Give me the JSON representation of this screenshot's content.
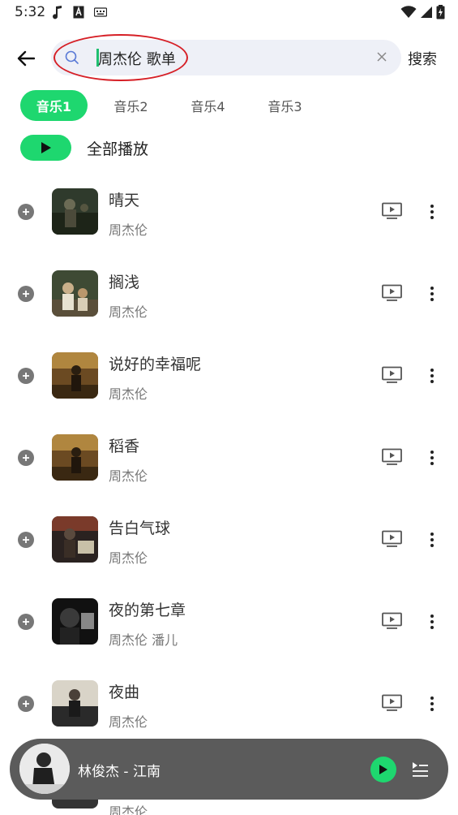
{
  "status_bar": {
    "time": "5:32",
    "icons": [
      "music-note-icon",
      "a-badge-icon",
      "keyboard-icon",
      "wifi-icon",
      "signal-icon",
      "battery-icon"
    ]
  },
  "search": {
    "query": "周杰伦 歌单",
    "submit_label": "搜索",
    "icons": [
      "back-arrow-icon",
      "search-icon",
      "clear-icon"
    ]
  },
  "tabs": [
    {
      "label": "音乐1",
      "active": true
    },
    {
      "label": "音乐2",
      "active": false
    },
    {
      "label": "音乐4",
      "active": false
    },
    {
      "label": "音乐3",
      "active": false
    }
  ],
  "play_all": {
    "label": "全部播放"
  },
  "songs": [
    {
      "title": "晴天",
      "artist": "周杰伦"
    },
    {
      "title": "搁浅",
      "artist": "周杰伦"
    },
    {
      "title": "说好的幸福呢",
      "artist": "周杰伦"
    },
    {
      "title": "稻香",
      "artist": "周杰伦"
    },
    {
      "title": "告白气球",
      "artist": "周杰伦"
    },
    {
      "title": "夜的第七章",
      "artist": "周杰伦 潘儿"
    },
    {
      "title": "夜曲",
      "artist": "周杰伦"
    }
  ],
  "partial_row": {
    "artist": "周杰伦"
  },
  "player": {
    "title": "林俊杰 - 江南"
  },
  "colors": {
    "accent": "#1ed76f",
    "search_bg": "#eef0f7",
    "player_bg": "#5b5b5b",
    "annotation_ellipse": "#d61f26"
  }
}
